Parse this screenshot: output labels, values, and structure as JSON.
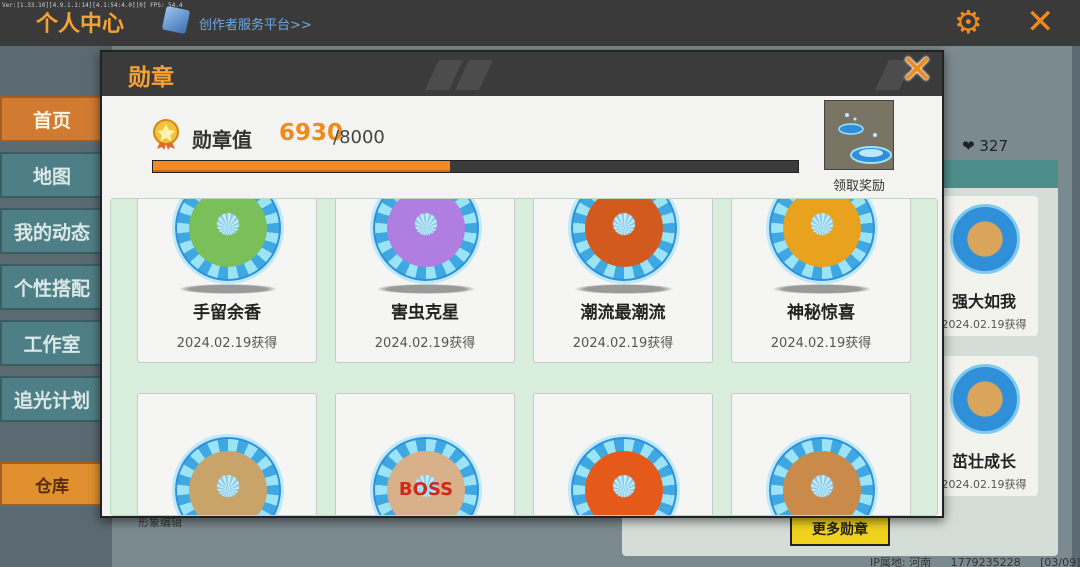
{
  "debug_text": "Ver:[1.33.10][4.9.1.1:14][4.1:54:4.0][0] FPS: 54.4",
  "background": {
    "title": "个人中心",
    "creator_link": "创作者服务平台>>",
    "sidebar": [
      "首页",
      "地图",
      "我的动态",
      "个性搭配",
      "工作室",
      "追光计划"
    ],
    "warehouse": "仓库",
    "likes": "327",
    "cards": [
      {
        "name": "强大如我",
        "date": "2024.02.19获得"
      },
      {
        "name": "茁壮成长",
        "date": "2024.02.19获得"
      }
    ],
    "more_button": "更多勋章",
    "edit_label": "形象编辑",
    "status_ip": "IP属地: 河南",
    "status_uid": "1779235228",
    "status_page": "[03/09]"
  },
  "modal": {
    "title": "勋章",
    "value_label": "勋章值",
    "value_current": "6930",
    "value_total": "/8000",
    "progress": 0.46,
    "reward_label": "领取奖励",
    "badges": [
      {
        "name": "手留余香",
        "date": "2024.02.19获得",
        "icon": "sprout-icon",
        "color": "#7bbf5a"
      },
      {
        "name": "害虫克星",
        "date": "2024.02.19获得",
        "icon": "worm-icon",
        "color": "#b07de0"
      },
      {
        "name": "潮流最潮流",
        "date": "2024.02.19获得",
        "icon": "trend-icon",
        "color": "#d35a1e"
      },
      {
        "name": "神秘惊喜",
        "date": "2024.02.19获得",
        "icon": "gift-icon",
        "color": "#e8a21e"
      },
      {
        "name": "",
        "date": "",
        "icon": "friends-icon",
        "color": "#c9a46a"
      },
      {
        "name": "",
        "date": "",
        "icon": "boss-icon",
        "color": "#d8b08a",
        "inner_text": "BOSS"
      },
      {
        "name": "",
        "date": "",
        "icon": "fire-icon",
        "color": "#e55a1a"
      },
      {
        "name": "",
        "date": "",
        "icon": "monkey-icon",
        "color": "#c98a4a"
      }
    ]
  }
}
